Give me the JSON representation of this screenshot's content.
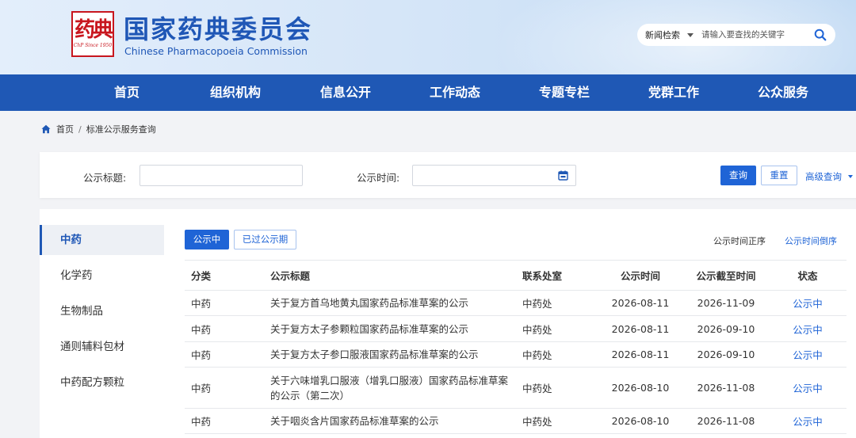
{
  "header": {
    "seal_glyph": "药典",
    "seal_since": "ChP Since 1950",
    "title_cn": "国家药典委员会",
    "title_en": "Chinese Pharmacopoeia Commission"
  },
  "search": {
    "type_label": "新闻检索",
    "placeholder": "请输入要查找的关键字",
    "value": ""
  },
  "nav": {
    "items": [
      "首页",
      "组织机构",
      "信息公开",
      "工作动态",
      "专题专栏",
      "党群工作",
      "公众服务"
    ]
  },
  "breadcrumb": {
    "home": "首页",
    "separator": "/",
    "current": "标准公示服务查询"
  },
  "filter": {
    "title_label": "公示标题:",
    "title_value": "",
    "time_label": "公示时间:",
    "time_value": "",
    "query_button": "查询",
    "reset_button": "重置",
    "advanced": "高级查询"
  },
  "sidebar": {
    "items": [
      "中药",
      "化学药",
      "生物制品",
      "通则辅料包材",
      "中药配方颗粒"
    ],
    "active_index": 0
  },
  "tabs": {
    "current": "公示中",
    "expired": "已过公示期"
  },
  "sort": {
    "asc": "公示时间正序",
    "desc": "公示时间倒序"
  },
  "table": {
    "columns": [
      "分类",
      "公示标题",
      "联系处室",
      "公示时间",
      "公示截至时间",
      "状态"
    ],
    "rows": [
      {
        "category": "中药",
        "title": "关于复方首乌地黄丸国家药品标准草案的公示",
        "office": "中药处",
        "start": "2026-08-11",
        "end": "2026-11-09",
        "status": "公示中"
      },
      {
        "category": "中药",
        "title": "关于复方太子参颗粒国家药品标准草案的公示",
        "office": "中药处",
        "start": "2026-08-11",
        "end": "2026-09-10",
        "status": "公示中"
      },
      {
        "category": "中药",
        "title": "关于复方太子参口服液国家药品标准草案的公示",
        "office": "中药处",
        "start": "2026-08-11",
        "end": "2026-09-10",
        "status": "公示中"
      },
      {
        "category": "中药",
        "title": "关于六味增乳口服液（增乳口服液）国家药品标准草案的公示（第二次）",
        "office": "中药处",
        "start": "2026-08-10",
        "end": "2026-11-08",
        "status": "公示中"
      },
      {
        "category": "中药",
        "title": "关于咽炎含片国家药品标准草案的公示",
        "office": "中药处",
        "start": "2026-08-10",
        "end": "2026-11-08",
        "status": "公示中"
      }
    ]
  },
  "colors": {
    "brand_blue": "#1f58b5",
    "accent_blue": "#1f64d6",
    "seal_red": "#c8161e"
  }
}
